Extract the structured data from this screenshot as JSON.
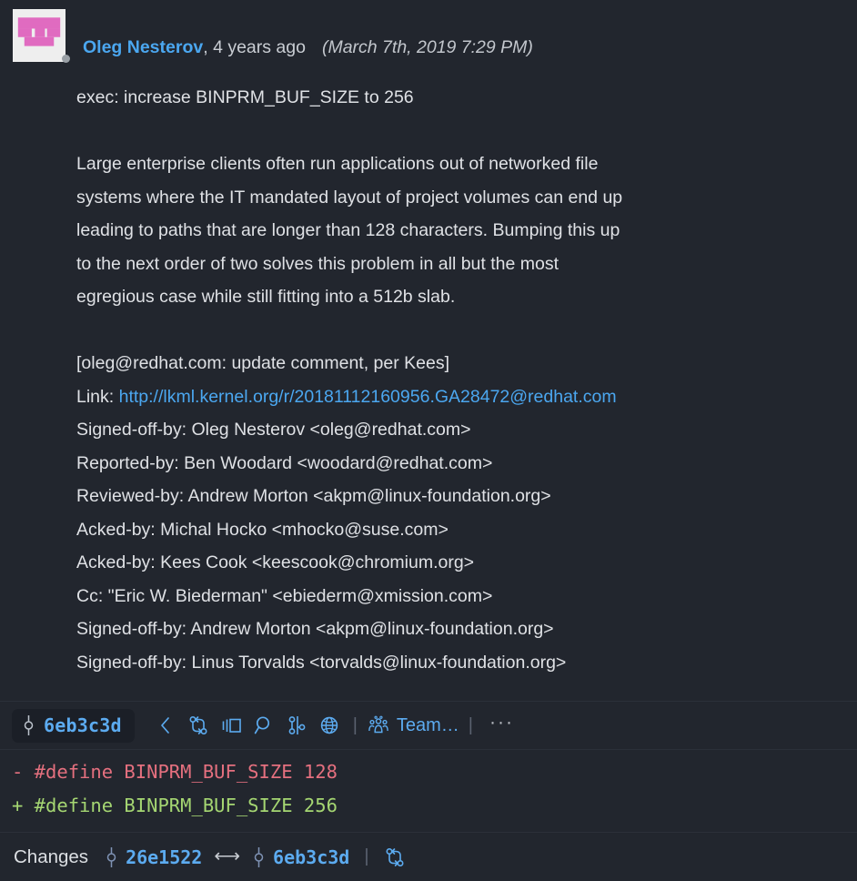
{
  "header": {
    "avatar_name": "user-identicon-avatar",
    "avatar_bg": "#eeeeee",
    "avatar_fg": "#e06bc0",
    "author": "Oleg Nesterov",
    "separator": ", ",
    "relative_time": "4 years ago",
    "absolute_date": "(March 7th, 2019 7:29 PM)"
  },
  "message": {
    "lines": [
      {
        "text": "exec: increase BINPRM_BUF_SIZE to 256",
        "type": "text"
      },
      {
        "text": "",
        "type": "blank"
      },
      {
        "text": "Large enterprise clients often run applications out of networked file",
        "type": "text"
      },
      {
        "text": "systems where the IT mandated layout of project volumes can end up",
        "type": "text"
      },
      {
        "text": "leading to paths that are longer than 128 characters. Bumping this up",
        "type": "text"
      },
      {
        "text": "to the next order of two solves this problem in all but the most",
        "type": "text"
      },
      {
        "text": "egregious case while still fitting into a 512b slab.",
        "type": "text"
      },
      {
        "text": "",
        "type": "blank"
      },
      {
        "text": "[oleg@redhat.com: update comment, per Kees]",
        "type": "text"
      },
      {
        "text": "Link: ",
        "type": "link",
        "link_text": "http://lkml.kernel.org/r/20181112160956.GA28472@redhat.com"
      },
      {
        "text": "Signed-off-by: Oleg Nesterov <oleg@redhat.com>",
        "type": "text"
      },
      {
        "text": "Reported-by: Ben Woodard <woodard@redhat.com>",
        "type": "text"
      },
      {
        "text": "Reviewed-by: Andrew Morton <akpm@linux-foundation.org>",
        "type": "text"
      },
      {
        "text": "Acked-by: Michal Hocko <mhocko@suse.com>",
        "type": "text"
      },
      {
        "text": "Acked-by: Kees Cook <keescook@chromium.org>",
        "type": "text"
      },
      {
        "text": "Cc: \"Eric W. Biederman\" <ebiederm@xmission.com>",
        "type": "text"
      },
      {
        "text": "Signed-off-by: Andrew Morton <akpm@linux-foundation.org>",
        "type": "text"
      },
      {
        "text": "Signed-off-by: Linus Torvalds <torvalds@linux-foundation.org>",
        "type": "text"
      }
    ]
  },
  "toolbar": {
    "commit_hash": "6eb3c3d",
    "icons": [
      "chevron-left-icon",
      "git-compare-icon",
      "split-view-icon",
      "search-icon",
      "git-graph-icon",
      "globe-icon"
    ],
    "separator": "|",
    "team_label": "Team…",
    "team_icon": "team-icon",
    "more_label": "···"
  },
  "diff": {
    "removed_marker": "-",
    "removed_text": "#define BINPRM_BUF_SIZE 128",
    "added_marker": "+",
    "added_text": "#define BINPRM_BUF_SIZE 256",
    "removed_color": "#e5707f",
    "added_color": "#a5d672"
  },
  "changes_bar": {
    "label": "Changes",
    "from_ref": "26e1522",
    "arrow": "⟷",
    "to_ref": "6eb3c3d",
    "separator": "|",
    "compare_icon": "git-compare-icon"
  },
  "colors": {
    "background": "#22262e",
    "accent_blue": "#5cabf0",
    "text": "#dfe1e5",
    "border": "#2b3039",
    "badge_bg": "#1b1f27"
  }
}
